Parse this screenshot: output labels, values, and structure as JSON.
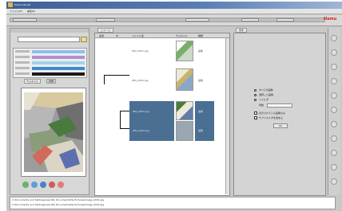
{
  "app": {
    "title": "Picture Recall",
    "menu": [
      "ファイル(F)",
      "編集(E)"
    ],
    "brand": "Hamu",
    "brand_color": "#d42020"
  },
  "left": {
    "search_placeholder": "",
    "tabs": [
      "サムネイル",
      "詳細"
    ],
    "bar_colors": [
      "#8fc0ea",
      "#b08fd8",
      "#9fd4e6",
      "#3f8ad0",
      "#1a1a1a"
    ],
    "color_buttons": [
      "#68b26a",
      "#5f9ed6",
      "#4f7fc6",
      "#d65757",
      "#e47b7b"
    ]
  },
  "center": {
    "tab": "イメージ",
    "columns": [
      "名前",
      "ID",
      "ファイル名",
      "サムネイル",
      "種類"
    ],
    "rows": [
      {
        "name": "",
        "id": "",
        "file": "IMG_0001.jpg",
        "type": "画像",
        "selected": false
      },
      {
        "name": "",
        "id": "",
        "file": "IMG_0002.jpg",
        "type": "画像",
        "selected": false
      },
      {
        "name": "",
        "id": "",
        "file": "IMG_0003.jpg",
        "type": "画像",
        "selected": true
      },
      {
        "name": "",
        "id": "",
        "file": "IMG_0004.jpg",
        "type": "画像",
        "selected": true
      }
    ],
    "selection_color": "#4a6f93"
  },
  "right": {
    "tab": "条件",
    "options": [
      "すべての画像",
      "選択した画像",
      "フォルダ",
      "表示されている画像のみ",
      "サブフォルダを含める"
    ],
    "field_label": "件数",
    "field_value": "",
    "ok_label": "OK"
  },
  "status": {
    "lines": [
      "C:\\Documents and Settings\\user\\My Documents\\My Pictures\\image_0001.jpg",
      "C:\\Documents and Settings\\user\\My Documents\\My Pictures\\image_0002.jpg"
    ]
  }
}
